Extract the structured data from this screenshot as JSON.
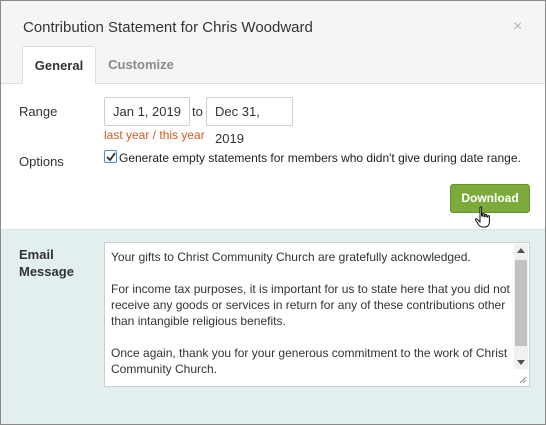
{
  "dialog": {
    "title": "Contribution Statement for Chris Woodward",
    "close_glyph": "×"
  },
  "tabs": [
    {
      "label": "General",
      "active": true
    },
    {
      "label": "Customize",
      "active": false
    }
  ],
  "range": {
    "label": "Range",
    "start_date": "Jan 1, 2019",
    "separator": "to",
    "end_date": "Dec 31, 2019",
    "preset_link": "last year / this year"
  },
  "options": {
    "label": "Options",
    "checkbox_checked": true,
    "checkbox_label": "Generate empty statements for members who didn't give during date range."
  },
  "download_button": {
    "label": "Download",
    "color": "#7bab3a"
  },
  "email": {
    "label": "Email Message",
    "message": "Your gifts to Christ Community Church are gratefully acknowledged.\n\nFor income tax purposes, it is important for us to state here that you did not receive any goods or services in return for any of these contributions other than intangible religious benefits.\n\nOnce again, thank you for your generous commitment to the work of Christ Community Church."
  },
  "colors": {
    "link": "#d35a1a",
    "lower_panel_bg": "#e3efee",
    "header_bg": "#f5f5f5"
  },
  "icons": {
    "close": "close-icon",
    "checkbox": "checkmark-icon",
    "cursor": "hand-pointer-icon",
    "resize": "resize-grip-icon"
  }
}
